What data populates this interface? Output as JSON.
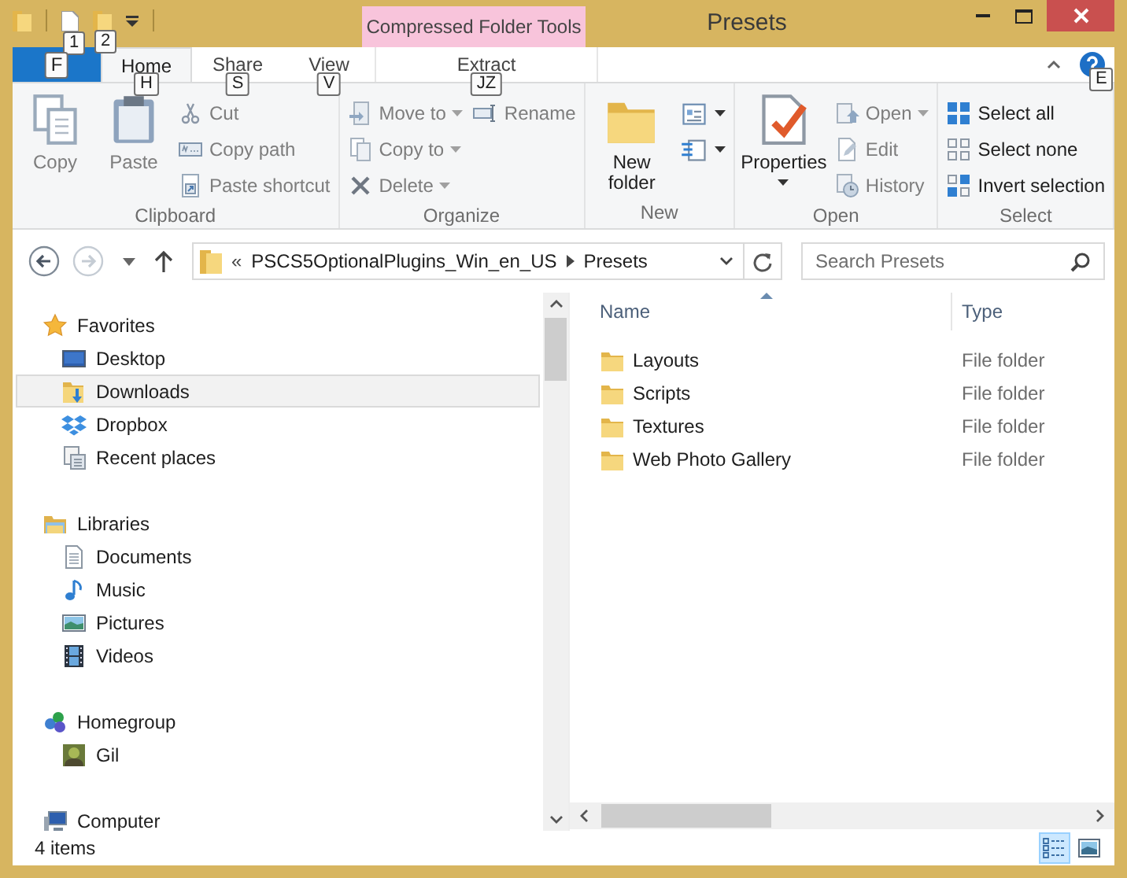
{
  "window": {
    "title": "Presets"
  },
  "quick_access": {
    "keytips": [
      "1",
      "2"
    ]
  },
  "contextual_tab": {
    "label": "Compressed Folder Tools"
  },
  "ribbon_tabs": [
    {
      "kind": "file",
      "keytip": "F",
      "selected": false
    },
    {
      "label": "Home",
      "kind": "normal",
      "keytip": "H",
      "selected": true
    },
    {
      "label": "Share",
      "kind": "normal",
      "keytip": "S",
      "selected": false
    },
    {
      "label": "View",
      "kind": "normal",
      "keytip": "V",
      "selected": false
    },
    {
      "label": "Extract",
      "kind": "contextual",
      "keytip": "JZ",
      "selected": false
    }
  ],
  "help": {
    "keytip": "E"
  },
  "ribbon_groups": [
    {
      "label": "Clipboard",
      "commands": [
        {
          "label": "Copy",
          "kind": "large",
          "disabled": true,
          "dropdown": false
        },
        {
          "label": "Paste",
          "kind": "large",
          "disabled": true,
          "dropdown": false
        },
        {
          "label": "Cut",
          "kind": "small",
          "disabled": true,
          "dropdown": false
        },
        {
          "label": "Copy path",
          "kind": "small",
          "disabled": true,
          "dropdown": false
        },
        {
          "label": "Paste shortcut",
          "kind": "small",
          "disabled": true,
          "dropdown": false
        }
      ]
    },
    {
      "label": "Organize",
      "commands": [
        {
          "label": "Move to",
          "kind": "small",
          "disabled": true,
          "dropdown": true
        },
        {
          "label": "Copy to",
          "kind": "small",
          "disabled": true,
          "dropdown": true
        },
        {
          "label": "Delete",
          "kind": "small",
          "disabled": true,
          "dropdown": true
        },
        {
          "label": "Rename",
          "kind": "small",
          "disabled": true,
          "dropdown": false
        }
      ]
    },
    {
      "label": "New",
      "commands": [
        {
          "label": "New folder",
          "kind": "large",
          "disabled": false,
          "dropdown": false
        },
        {
          "kind": "icon",
          "disabled": false,
          "dropdown": true
        },
        {
          "kind": "icon",
          "disabled": false,
          "dropdown": true
        }
      ]
    },
    {
      "label": "Open",
      "commands": [
        {
          "label": "Properties",
          "kind": "large",
          "disabled": false,
          "dropdown": true
        },
        {
          "label": "Open",
          "kind": "small",
          "disabled": true,
          "dropdown": true
        },
        {
          "label": "Edit",
          "kind": "small",
          "disabled": true,
          "dropdown": false
        },
        {
          "label": "History",
          "kind": "small",
          "disabled": true,
          "dropdown": false
        }
      ]
    },
    {
      "label": "Select",
      "commands": [
        {
          "label": "Select all",
          "kind": "small",
          "disabled": false,
          "dropdown": false
        },
        {
          "label": "Select none",
          "kind": "small",
          "disabled": false,
          "dropdown": false
        },
        {
          "label": "Invert selection",
          "kind": "small",
          "disabled": false,
          "dropdown": false
        }
      ]
    }
  ],
  "address": {
    "overflow": "«",
    "crumbs": [
      "PSCS5OptionalPlugins_Win_en_US",
      "Presets"
    ]
  },
  "search": {
    "placeholder": "Search Presets"
  },
  "navigation": [
    {
      "label": "Favorites",
      "selected": false,
      "children": [
        {
          "label": "Desktop",
          "selected": false
        },
        {
          "label": "Downloads",
          "selected": true
        },
        {
          "label": "Dropbox",
          "selected": false
        },
        {
          "label": "Recent places",
          "selected": false
        }
      ]
    },
    {
      "label": "Libraries",
      "selected": false,
      "children": [
        {
          "label": "Documents",
          "selected": false
        },
        {
          "label": "Music",
          "selected": false
        },
        {
          "label": "Pictures",
          "selected": false
        },
        {
          "label": "Videos",
          "selected": false
        }
      ]
    },
    {
      "label": "Homegroup",
      "selected": false,
      "children": [
        {
          "label": "Gil",
          "selected": false
        }
      ]
    },
    {
      "label": "Computer",
      "selected": false
    }
  ],
  "file_list": {
    "columns": [
      {
        "label": "Name",
        "sorted": true
      },
      {
        "label": "Type",
        "sorted": false
      }
    ],
    "rows": [
      {
        "name": "Layouts",
        "type": "File folder"
      },
      {
        "name": "Scripts",
        "type": "File folder"
      },
      {
        "name": "Textures",
        "type": "File folder"
      },
      {
        "name": "Web Photo Gallery",
        "type": "File folder"
      }
    ]
  },
  "status_bar": {
    "text": "4 items",
    "views": [
      {
        "selected": true
      },
      {
        "selected": false
      }
    ]
  }
}
